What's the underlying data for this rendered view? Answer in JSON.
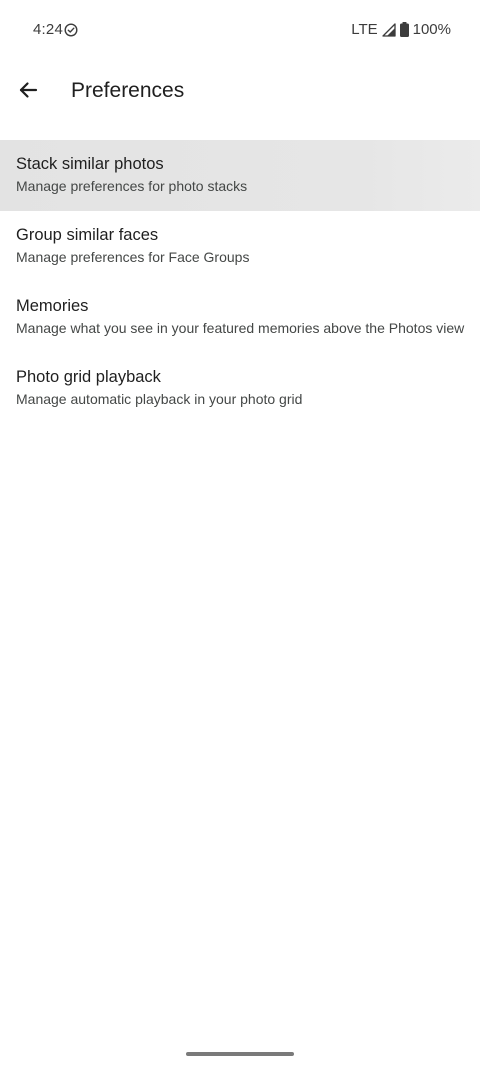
{
  "status_bar": {
    "time": "4:24",
    "network": "LTE",
    "battery": "100%",
    "icons": [
      "check-circle-icon",
      "signal-icon",
      "battery-icon"
    ]
  },
  "app_bar": {
    "title": "Preferences",
    "back_icon": "arrow-back-icon"
  },
  "preferences": [
    {
      "title": "Stack similar photos",
      "subtitle": "Manage preferences for photo stacks",
      "highlighted": true
    },
    {
      "title": "Group similar faces",
      "subtitle": "Manage preferences for Face Groups",
      "highlighted": false
    },
    {
      "title": "Memories",
      "subtitle": "Manage what you see in your featured memories above the Photos view",
      "highlighted": false
    },
    {
      "title": "Photo grid playback",
      "subtitle": "Manage automatic playback in your photo grid",
      "highlighted": false
    }
  ],
  "colors": {
    "background": "#ffffff",
    "text_primary": "#1f1f1f",
    "text_secondary": "#444746",
    "highlight": "#e4e4e4"
  }
}
